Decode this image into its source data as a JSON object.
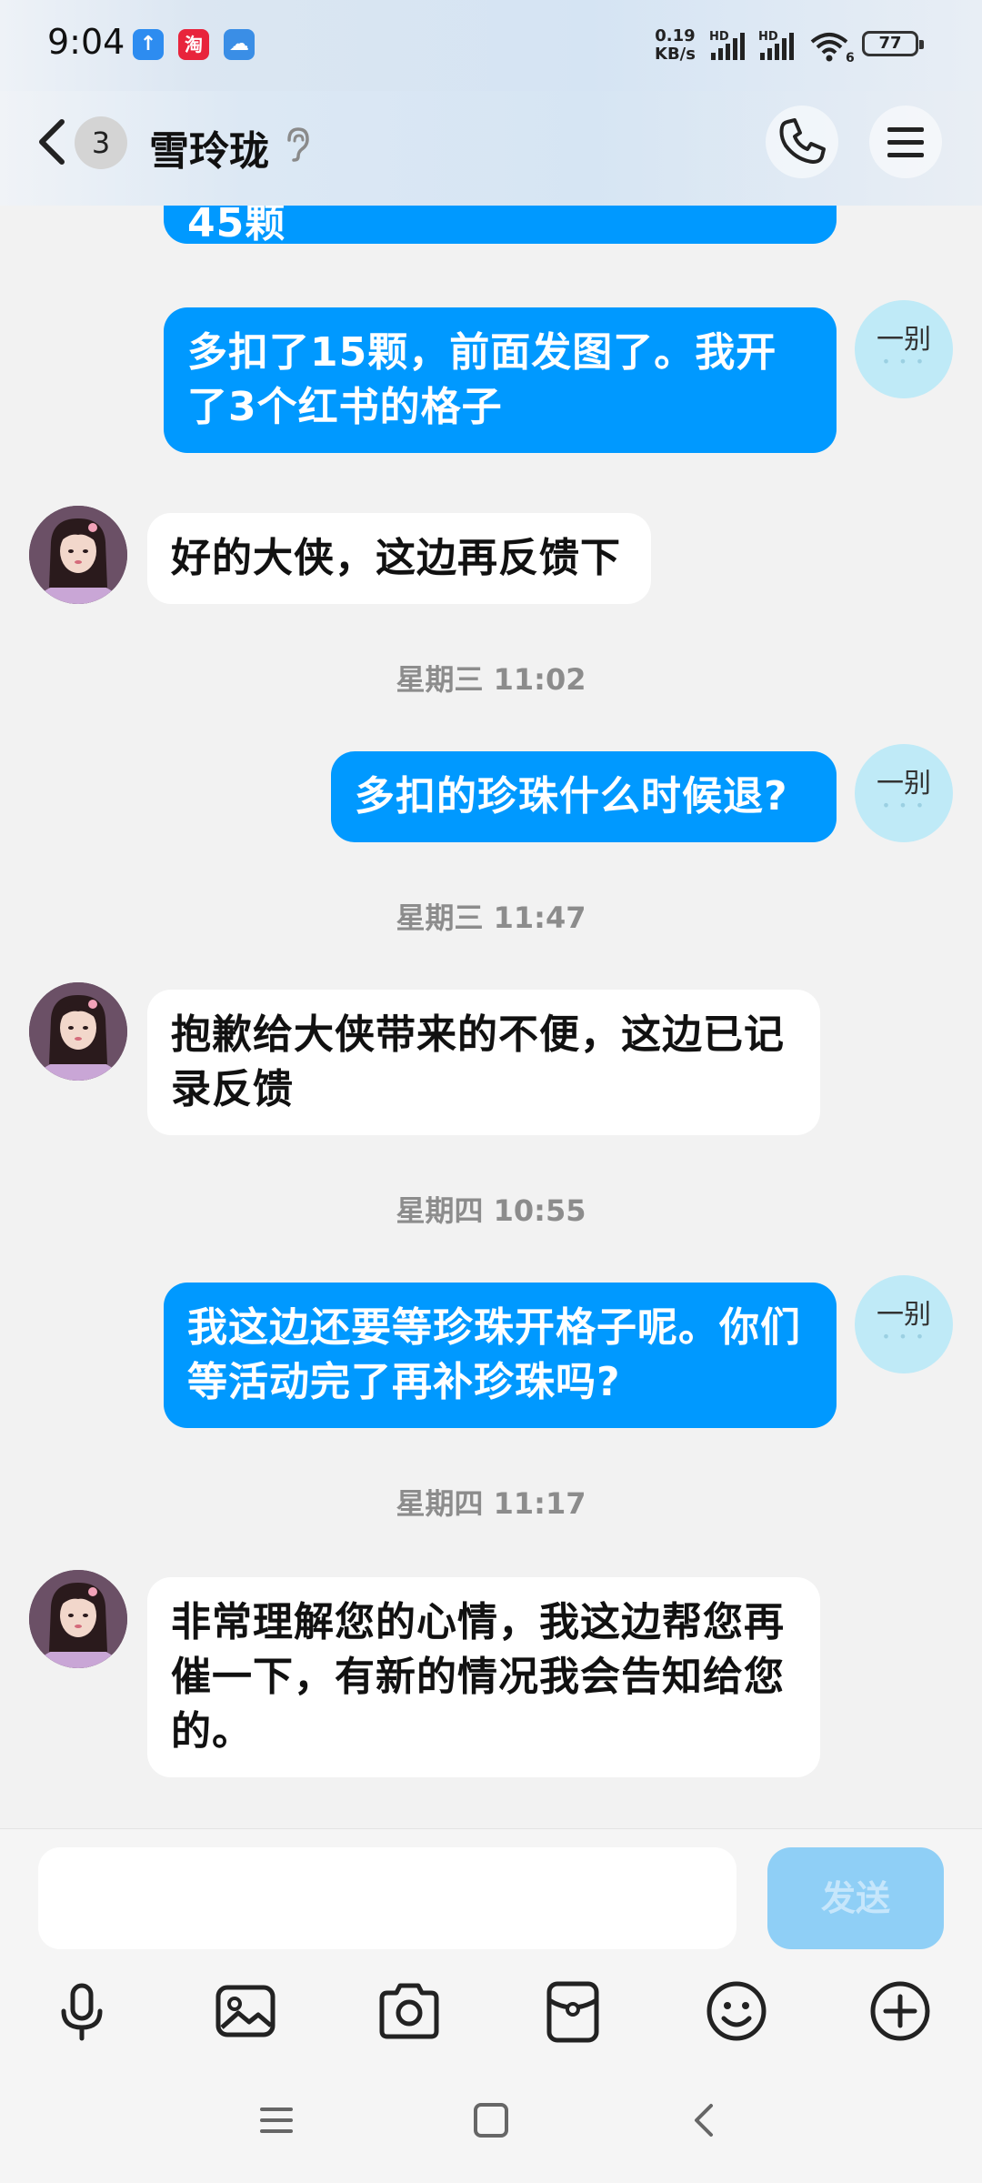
{
  "status_bar": {
    "time": "9:04",
    "apps": [
      {
        "name": "upload-app",
        "glyph": "↑",
        "color": "#2d8cf0"
      },
      {
        "name": "taobao-app",
        "glyph": "淘",
        "color": "#e8243c"
      },
      {
        "name": "cloud-app",
        "glyph": "☁",
        "color": "#3a8ee6"
      }
    ],
    "net_speed_value": "0.19",
    "net_speed_unit": "KB/s",
    "hd1": "HD",
    "hd2": "HD",
    "wifi_label": "6",
    "battery": "77"
  },
  "header": {
    "unread_count": "3",
    "contact_name": "雪玲珑"
  },
  "messages": [
    {
      "type": "out",
      "text": "45颗",
      "partial": true
    },
    {
      "type": "out",
      "lines": [
        "多扣了15颗，前面发图了。我开",
        "了3个红书的格子"
      ],
      "avatar_text": "一别"
    },
    {
      "type": "in",
      "lines": [
        "好的大侠，这边再反馈下"
      ]
    },
    {
      "type": "time",
      "text": "星期三 11:02"
    },
    {
      "type": "out",
      "lines": [
        "多扣的珍珠什么时候退?"
      ],
      "avatar_text": "一别"
    },
    {
      "type": "time",
      "text": "星期三 11:47"
    },
    {
      "type": "in",
      "lines": [
        "抱歉给大侠带来的不便，这边已记",
        "录反馈"
      ]
    },
    {
      "type": "time",
      "text": "星期四 10:55"
    },
    {
      "type": "out",
      "lines": [
        "我这边还要等珍珠开格子呢。你们",
        "等活动完了再补珍珠吗?"
      ],
      "avatar_text": "一别"
    },
    {
      "type": "time",
      "text": "星期四 11:17"
    },
    {
      "type": "in",
      "lines": [
        "非常理解您的心情，我这边帮您再",
        "催一下，有新的情况我会告知给您",
        "的。"
      ]
    }
  ],
  "input": {
    "value": "",
    "send_label": "发送"
  },
  "toolbar": [
    "mic-icon",
    "image-icon",
    "camera-icon",
    "red-packet-icon",
    "emoji-icon",
    "plus-icon"
  ],
  "colors": {
    "accent": "#0099ff",
    "send_disabled": "#8fcff6",
    "my_avatar_bg": "#bfeaf7"
  }
}
